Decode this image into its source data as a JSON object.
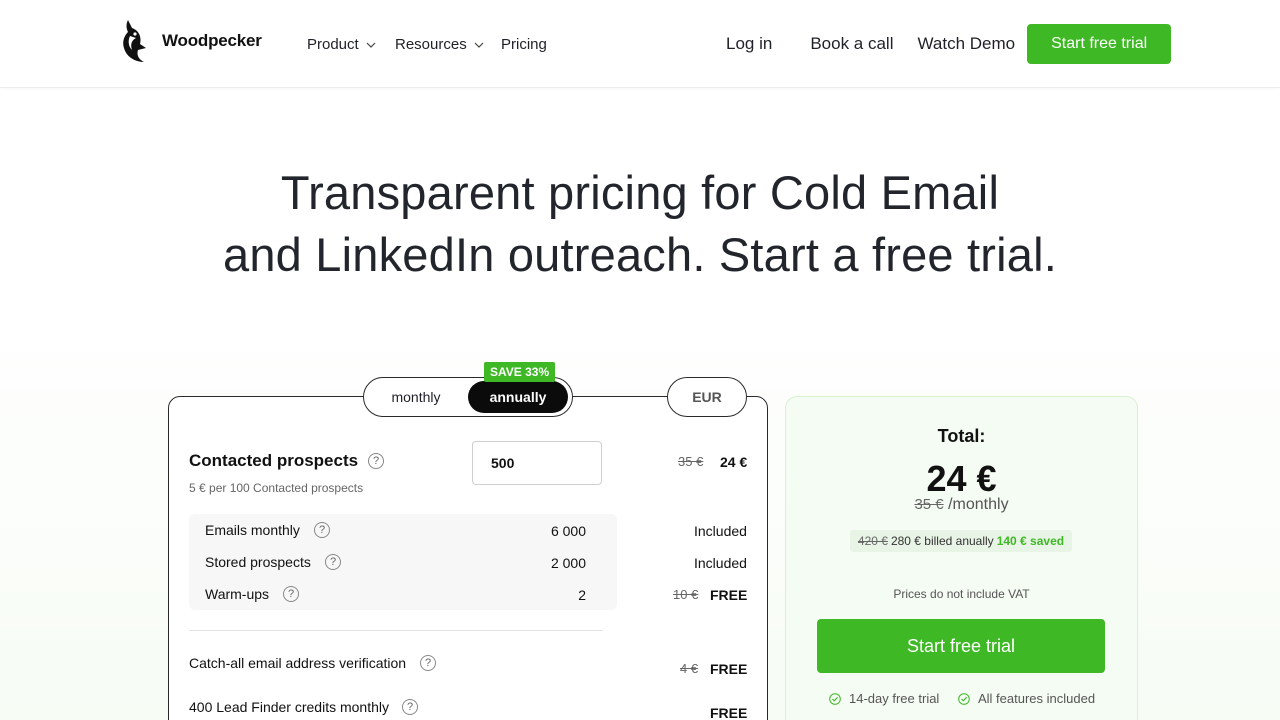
{
  "header": {
    "brand": "Woodpecker",
    "nav": [
      {
        "label": "Product"
      },
      {
        "label": "Resources"
      },
      {
        "label": "Pricing"
      }
    ],
    "login": "Log in",
    "book_call": "Book a call",
    "watch_demo": "Watch Demo",
    "cta": "Start free trial"
  },
  "hero": {
    "line1": "Transparent pricing for Cold Email",
    "line2": "and LinkedIn outreach. Start a free trial."
  },
  "billing": {
    "monthly": "monthly",
    "annually": "annually",
    "selected": "annually",
    "save_badge": "SAVE 33%",
    "currency": "EUR"
  },
  "calculator": {
    "contacted": {
      "title": "Contacted prospects",
      "help": "?",
      "subtitle": "5 € per 100 Contacted prospects",
      "input_value": "500",
      "old_price": "35 €",
      "price": "24 €"
    },
    "included_rows": [
      {
        "label": "Emails monthly",
        "value": "6 000",
        "price": "Included"
      },
      {
        "label": "Stored prospects",
        "value": "2 000",
        "price": "Included"
      },
      {
        "label": "Warm-ups",
        "value": "2",
        "old_price": "10 €",
        "price": "FREE"
      }
    ],
    "addons": [
      {
        "label": "Catch-all email address verification",
        "old_price": "4 €",
        "price": "FREE"
      },
      {
        "label": "400 Lead Finder credits monthly",
        "price": "FREE"
      }
    ]
  },
  "summary": {
    "total_label": "Total:",
    "total": "24 €",
    "old_monthly": "35 €",
    "per": "/monthly",
    "billed_old": "420 €",
    "billed_text": "280 € billed anually",
    "saved": "140 € saved",
    "vat_note": "Prices do not include VAT",
    "cta": "Start free trial",
    "features": [
      "14-day free trial",
      "All features included"
    ]
  },
  "colors": {
    "brand_green": "#3fb826",
    "dark": "#0b0b0b"
  },
  "icons": [
    "woodpecker-logo-icon",
    "chevron-down-icon",
    "help-icon",
    "check-circle-icon"
  ]
}
